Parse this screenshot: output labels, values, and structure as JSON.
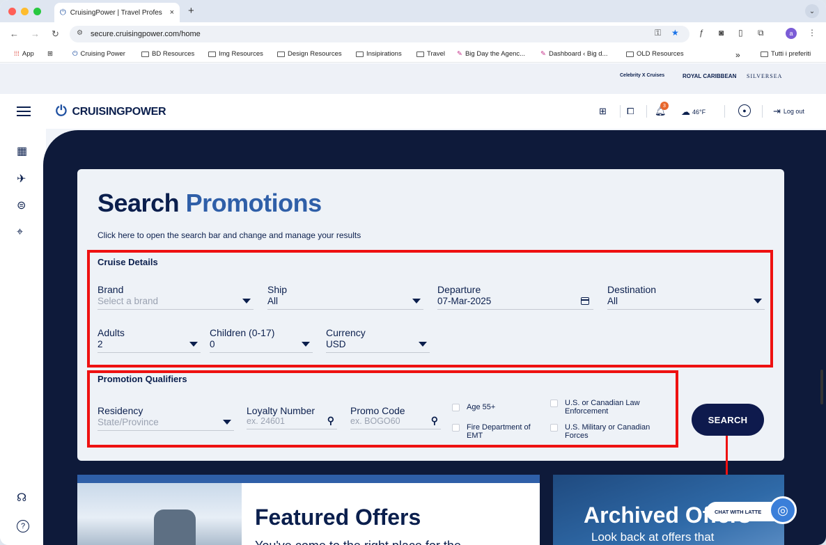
{
  "browser": {
    "tab_title": "CruisingPower | Travel Profes",
    "tab_close": "×",
    "new_tab": "+",
    "url": "secure.cruisingpower.com/home",
    "bookmarks": [
      "App",
      "Cruising Power",
      "BD Resources",
      "Img Resources",
      "Design Resources",
      "Insipirations",
      "Travel",
      "Big Day the Agenc...",
      "Dashboard ‹ Big d...",
      "OLD Resources"
    ],
    "more_bookmarks": "»",
    "all_bookmarks": "Tutti i preferiti",
    "profile_initial": "a"
  },
  "partners": [
    "Celebrity X Cruises",
    "ROYAL CARIBBEAN",
    "SILVERSEA"
  ],
  "header": {
    "logo_text": "CRUISINGPOWER",
    "notification_count": "3",
    "temperature": "46°F",
    "logout_label": "Log out"
  },
  "search": {
    "title_part1": "Search",
    "title_part2": "Promotions",
    "subtitle": "Click here to open the search bar and change and manage your results",
    "cruise_details_heading": "Cruise Details",
    "brand_label": "Brand",
    "brand_placeholder": "Select a brand",
    "ship_label": "Ship",
    "ship_value": "All",
    "departure_label": "Departure",
    "departure_value": "07-Mar-2025",
    "destination_label": "Destination",
    "destination_value": "All",
    "adults_label": "Adults",
    "adults_value": "2",
    "children_label": "Children (0-17)",
    "children_value": "0",
    "currency_label": "Currency",
    "currency_value": "USD",
    "qualifiers_heading": "Promotion Qualifiers",
    "residency_label": "Residency",
    "residency_placeholder": "State/Province",
    "loyalty_label": "Loyalty Number",
    "loyalty_placeholder": "ex. 24601",
    "promo_label": "Promo Code",
    "promo_placeholder": "ex. BOGO60",
    "check_age": "Age 55+",
    "check_fire": "Fire Department of EMT",
    "check_law": "U.S. or Canadian Law Enforcement",
    "check_military": "U.S. Military or Canadian Forces",
    "search_button": "SEARCH"
  },
  "featured": {
    "title": "Featured Offers",
    "subtitle": "You've come to the right place for the"
  },
  "archived": {
    "title": "Archived Offers",
    "subtitle": "Look back at offers that"
  },
  "chat": {
    "label": "CHAT WITH LATTE"
  },
  "colors": {
    "navy": "#0b1f4d",
    "accent_blue": "#2f5fa8",
    "highlight_red": "#ee1111",
    "badge_orange": "#e8672d"
  }
}
